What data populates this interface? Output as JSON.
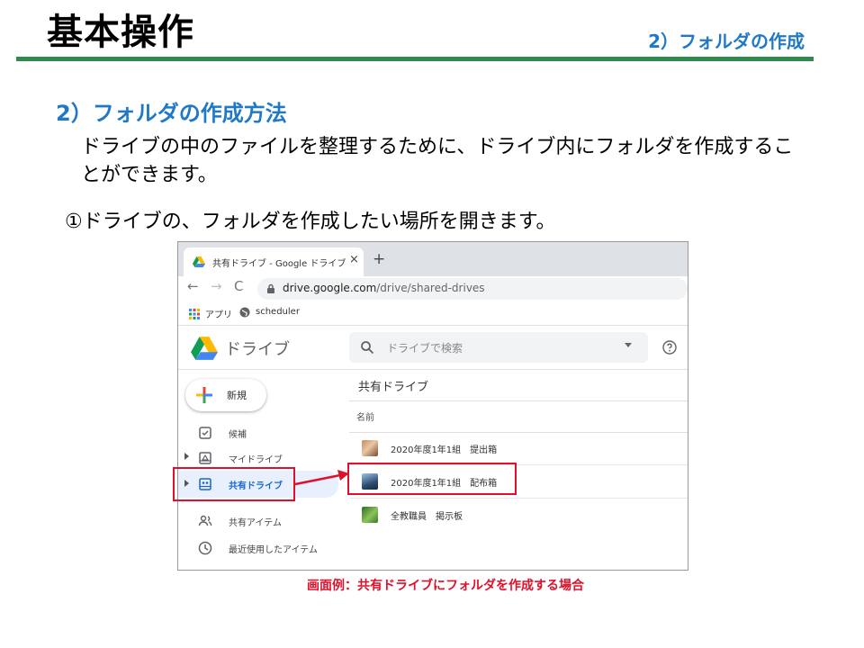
{
  "slide": {
    "title": "基本操作",
    "section": "2）フォルダの作成",
    "heading": "2）フォルダの作成方法",
    "intro": "ドライブの中のファイルを整理するために、ドライブ内にフォルダを作成することができます。",
    "step": "①ドライブの、フォルダを作成したい場所を開きます。",
    "caption": "画面例：共有ドライブにフォルダを作成する場合"
  },
  "browser": {
    "tab_title": "共有ドライブ - Google ドライブ",
    "tab_close": "×",
    "new_tab": "+",
    "back": "←",
    "forward": "→",
    "reload": "C",
    "url_host": "drive.google.com",
    "url_path": "/drive/shared-drives",
    "bookmark_apps": "アプリ",
    "bookmark_scheduler": "scheduler"
  },
  "drive": {
    "app_name": "ドライブ",
    "search_placeholder": "ドライブで検索",
    "new_button": "新規",
    "nav": [
      {
        "label": "候補",
        "icon": "check-box-icon"
      },
      {
        "label": "マイドライブ",
        "icon": "my-drive-icon"
      },
      {
        "label": "共有ドライブ",
        "icon": "shared-drive-icon"
      },
      {
        "label": "共有アイテム",
        "icon": "people-icon"
      },
      {
        "label": "最近使用したアイテム",
        "icon": "clock-icon"
      }
    ],
    "content_title": "共有ドライブ",
    "column_name": "名前",
    "drives": [
      {
        "name": "2020年度1年1組　提出箱"
      },
      {
        "name": "2020年度1年1組　配布箱"
      },
      {
        "name": "全教職員　掲示板"
      }
    ]
  },
  "colors": {
    "accent_blue": "#1f78c8",
    "rule_green": "#2e8b4e",
    "highlight_red": "#e0102a"
  }
}
